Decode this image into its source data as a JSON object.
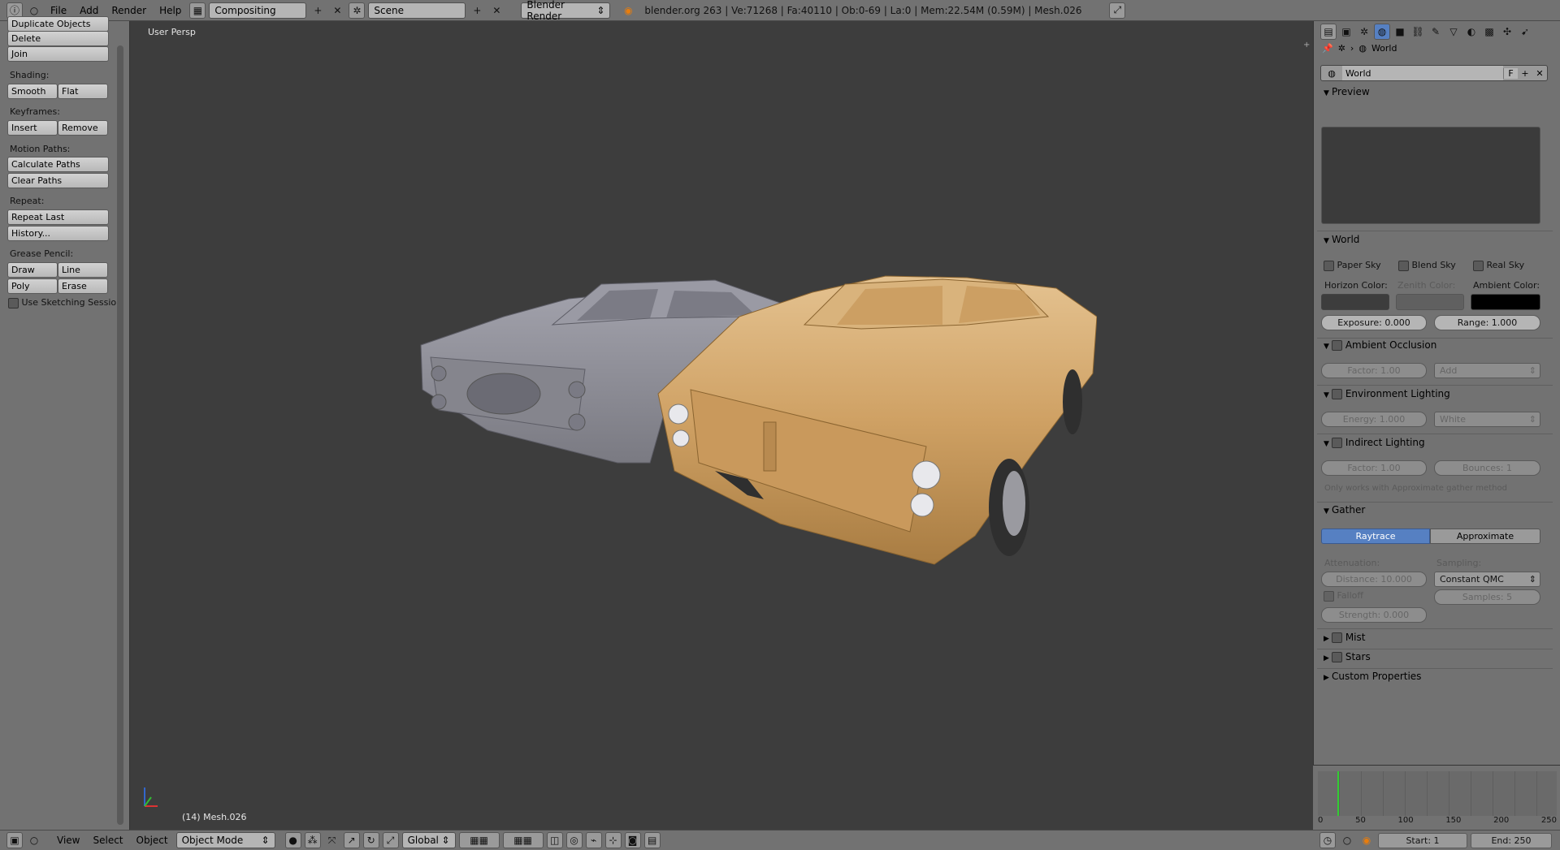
{
  "topbar": {
    "menus": [
      "File",
      "Add",
      "Render",
      "Help"
    ],
    "layout": "Compositing",
    "scene": "Scene",
    "engine": "Blender Render",
    "stats": "blender.org 263 | Ve:71268 | Fa:40110 | Ob:0-69 | La:0 | Mem:22.54M (0.59M) | Mesh.026"
  },
  "toolshelf": {
    "top_buttons": [
      "Duplicate Objects",
      "Delete",
      "Join"
    ],
    "shading_label": "Shading:",
    "shading": [
      "Smooth",
      "Flat"
    ],
    "keyframes_label": "Keyframes:",
    "keyframes": [
      "Insert",
      "Remove"
    ],
    "motion_label": "Motion Paths:",
    "motion": [
      "Calculate Paths",
      "Clear Paths"
    ],
    "repeat_label": "Repeat:",
    "repeat": [
      "Repeat Last",
      "History..."
    ],
    "grease_label": "Grease Pencil:",
    "grease": [
      "Draw",
      "Line",
      "Poly",
      "Erase"
    ],
    "sketching": "Use Sketching Sessio"
  },
  "viewport": {
    "view_label": "User Persp",
    "object_label": "(14) Mesh.026"
  },
  "vheader": {
    "menus": [
      "View",
      "Select",
      "Object"
    ],
    "mode": "Object Mode",
    "orientation": "Global"
  },
  "props": {
    "breadcrumb": "World",
    "datablock": "World",
    "fake_user": "F",
    "preview": "Preview",
    "world_header": "World",
    "paper_sky": "Paper Sky",
    "blend_sky": "Blend Sky",
    "real_sky": "Real Sky",
    "horizon_color": "Horizon Color:",
    "zenith_color": "Zenith Color:",
    "ambient_color": "Ambient Color:",
    "exposure": "Exposure: 0.000",
    "range": "Range: 1.000",
    "ao_header": "Ambient Occlusion",
    "ao_factor": "Factor: 1.00",
    "ao_blend": "Add",
    "env_header": "Environment Lighting",
    "env_energy": "Energy: 1.000",
    "env_color": "White",
    "ind_header": "Indirect Lighting",
    "ind_factor": "Factor: 1.00",
    "ind_bounces": "Bounces: 1",
    "ind_note": "Only works with Approximate gather method",
    "gather_header": "Gather",
    "gather_raytrace": "Raytrace",
    "gather_approx": "Approximate",
    "attenuation": "Attenuation:",
    "sampling": "Sampling:",
    "distance": "Distance: 10.000",
    "sampling_method": "Constant QMC",
    "falloff": "Falloff",
    "samples": "Samples: 5",
    "strength": "Strength: 0.000",
    "mist": "Mist",
    "stars": "Stars",
    "custom": "Custom Properties"
  },
  "timeline": {
    "ticks": [
      "0",
      "50",
      "100",
      "150",
      "200",
      "250"
    ],
    "start": "Start: 1",
    "end": "End: 250"
  },
  "colors": {
    "ui_gray": "#727272",
    "viewport_bg": "#3d3d3d",
    "accent_blue": "#5680c2",
    "car_gold": "#d2a86a",
    "car_gray": "#8e8e96"
  }
}
